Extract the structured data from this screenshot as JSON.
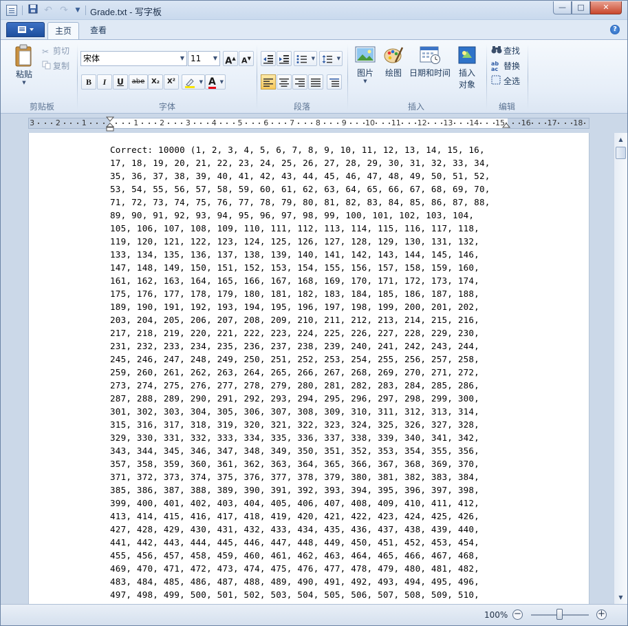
{
  "window": {
    "title": "Grade.txt - 写字板"
  },
  "tabs": {
    "home": "主页",
    "view": "查看"
  },
  "clipboard": {
    "group_label": "剪贴板",
    "paste": "粘贴",
    "cut": "剪切",
    "copy": "复制"
  },
  "font": {
    "group_label": "字体",
    "family": "宋体",
    "size": "11",
    "grow": "A",
    "shrink": "A",
    "bold": "B",
    "italic": "I",
    "underline": "U",
    "strike": "abe",
    "subscript": "X₂",
    "superscript": "X²",
    "color_letter": "A",
    "highlight_color": "#f7e400",
    "text_color": "#e60012"
  },
  "paragraph": {
    "group_label": "段落"
  },
  "insert": {
    "group_label": "插入",
    "picture": "图片",
    "paint": "绘图",
    "datetime": "日期和时间",
    "object_line1": "插入",
    "object_line2": "对象"
  },
  "editing": {
    "group_label": "编辑",
    "find": "查找",
    "replace": "替换",
    "select_all": "全选"
  },
  "ruler": {
    "left_numbers": [
      "3",
      "2",
      "1"
    ],
    "right_numbers": [
      "1",
      "2",
      "3",
      "4",
      "5",
      "6",
      "7",
      "8",
      "9",
      "10",
      "11",
      "12",
      "13",
      "14",
      "15",
      "16",
      "17",
      "18"
    ]
  },
  "document": {
    "lines": [
      "Correct: 10000 (1, 2, 3, 4, 5, 6, 7, 8, 9, 10, 11, 12, 13, 14, 15, 16,",
      "17, 18, 19, 20, 21, 22, 23, 24, 25, 26, 27, 28, 29, 30, 31, 32, 33, 34,",
      "35, 36, 37, 38, 39, 40, 41, 42, 43, 44, 45, 46, 47, 48, 49, 50, 51, 52,",
      "53, 54, 55, 56, 57, 58, 59, 60, 61, 62, 63, 64, 65, 66, 67, 68, 69, 70,",
      "71, 72, 73, 74, 75, 76, 77, 78, 79, 80, 81, 82, 83, 84, 85, 86, 87, 88,",
      "89, 90, 91, 92, 93, 94, 95, 96, 97, 98, 99, 100, 101, 102, 103, 104,",
      "105, 106, 107, 108, 109, 110, 111, 112, 113, 114, 115, 116, 117, 118,",
      "119, 120, 121, 122, 123, 124, 125, 126, 127, 128, 129, 130, 131, 132,",
      "133, 134, 135, 136, 137, 138, 139, 140, 141, 142, 143, 144, 145, 146,",
      "147, 148, 149, 150, 151, 152, 153, 154, 155, 156, 157, 158, 159, 160,",
      "161, 162, 163, 164, 165, 166, 167, 168, 169, 170, 171, 172, 173, 174,",
      "175, 176, 177, 178, 179, 180, 181, 182, 183, 184, 185, 186, 187, 188,",
      "189, 190, 191, 192, 193, 194, 195, 196, 197, 198, 199, 200, 201, 202,",
      "203, 204, 205, 206, 207, 208, 209, 210, 211, 212, 213, 214, 215, 216,",
      "217, 218, 219, 220, 221, 222, 223, 224, 225, 226, 227, 228, 229, 230,",
      "231, 232, 233, 234, 235, 236, 237, 238, 239, 240, 241, 242, 243, 244,",
      "245, 246, 247, 248, 249, 250, 251, 252, 253, 254, 255, 256, 257, 258,",
      "259, 260, 261, 262, 263, 264, 265, 266, 267, 268, 269, 270, 271, 272,",
      "273, 274, 275, 276, 277, 278, 279, 280, 281, 282, 283, 284, 285, 286,",
      "287, 288, 289, 290, 291, 292, 293, 294, 295, 296, 297, 298, 299, 300,",
      "301, 302, 303, 304, 305, 306, 307, 308, 309, 310, 311, 312, 313, 314,",
      "315, 316, 317, 318, 319, 320, 321, 322, 323, 324, 325, 326, 327, 328,",
      "329, 330, 331, 332, 333, 334, 335, 336, 337, 338, 339, 340, 341, 342,",
      "343, 344, 345, 346, 347, 348, 349, 350, 351, 352, 353, 354, 355, 356,",
      "357, 358, 359, 360, 361, 362, 363, 364, 365, 366, 367, 368, 369, 370,",
      "371, 372, 373, 374, 375, 376, 377, 378, 379, 380, 381, 382, 383, 384,",
      "385, 386, 387, 388, 389, 390, 391, 392, 393, 394, 395, 396, 397, 398,",
      "399, 400, 401, 402, 403, 404, 405, 406, 407, 408, 409, 410, 411, 412,",
      "413, 414, 415, 416, 417, 418, 419, 420, 421, 422, 423, 424, 425, 426,",
      "427, 428, 429, 430, 431, 432, 433, 434, 435, 436, 437, 438, 439, 440,",
      "441, 442, 443, 444, 445, 446, 447, 448, 449, 450, 451, 452, 453, 454,",
      "455, 456, 457, 458, 459, 460, 461, 462, 463, 464, 465, 466, 467, 468,",
      "469, 470, 471, 472, 473, 474, 475, 476, 477, 478, 479, 480, 481, 482,",
      "483, 484, 485, 486, 487, 488, 489, 490, 491, 492, 493, 494, 495, 496,",
      "497, 498, 499, 500, 501, 502, 503, 504, 505, 506, 507, 508, 509, 510,"
    ]
  },
  "status": {
    "zoom": "100%"
  },
  "colors": {
    "ribbon_bg": "#f5f9fd",
    "window_frame": "#6b84a5",
    "selected_button": "#f8c85a"
  }
}
